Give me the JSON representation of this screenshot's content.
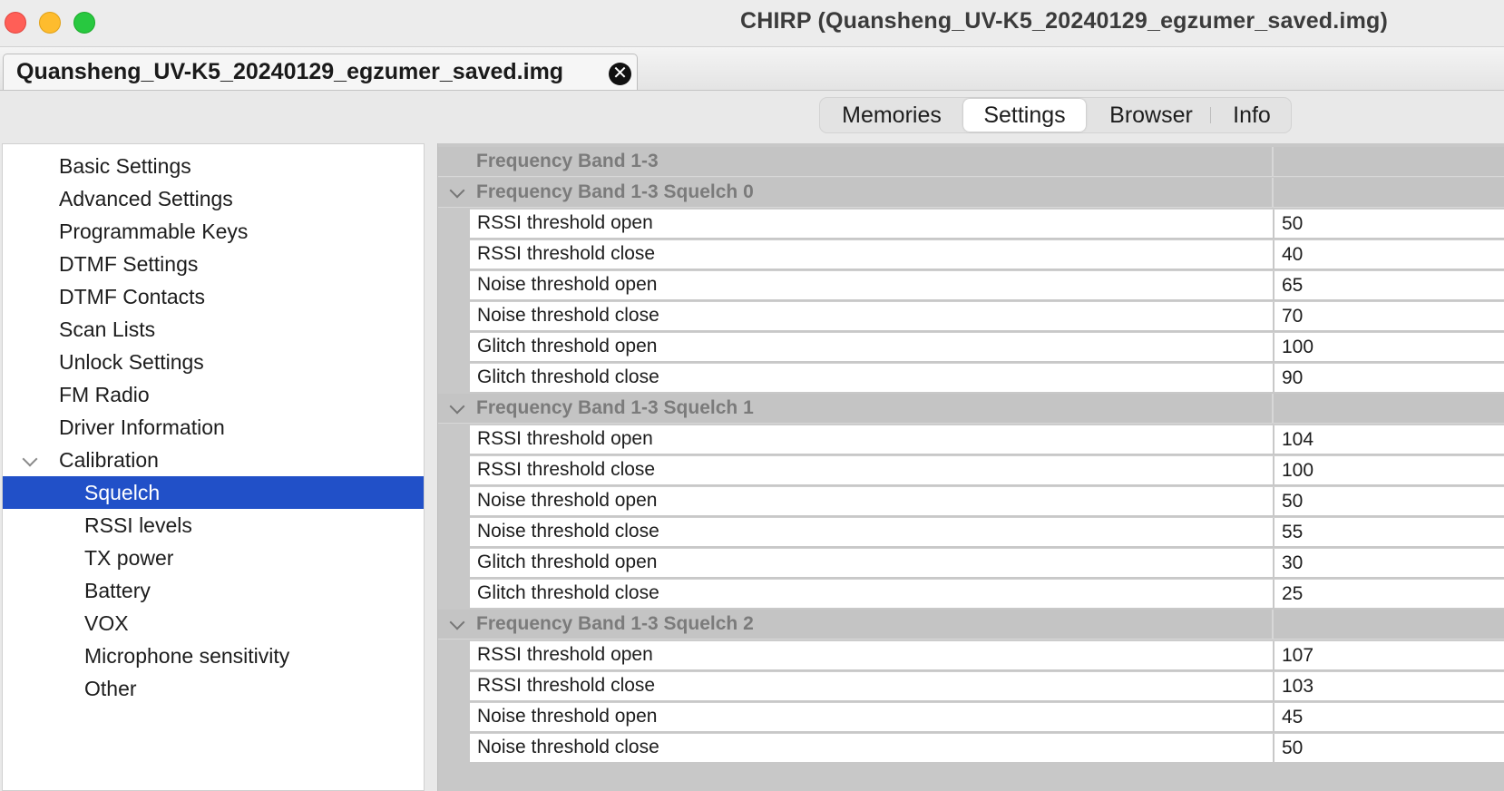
{
  "window": {
    "title": "CHIRP (Quansheng_UV-K5_20240129_egzumer_saved.img)"
  },
  "doc_tab": {
    "label": "Quansheng_UV-K5_20240129_egzumer_saved.img",
    "close_icon": "close-icon"
  },
  "view_tabs": {
    "items": [
      "Memories",
      "Settings",
      "Browser",
      "Info"
    ],
    "selected": "Settings"
  },
  "tree": {
    "items": [
      {
        "label": "Basic Settings",
        "level": 0
      },
      {
        "label": "Advanced Settings",
        "level": 0
      },
      {
        "label": "Programmable Keys",
        "level": 0
      },
      {
        "label": "DTMF Settings",
        "level": 0
      },
      {
        "label": "DTMF Contacts",
        "level": 0
      },
      {
        "label": "Scan Lists",
        "level": 0
      },
      {
        "label": "Unlock Settings",
        "level": 0
      },
      {
        "label": "FM Radio",
        "level": 0
      },
      {
        "label": "Driver Information",
        "level": 0
      },
      {
        "label": "Calibration",
        "level": 0,
        "expanded": true
      },
      {
        "label": "Squelch",
        "level": 1,
        "selected": true
      },
      {
        "label": "RSSI levels",
        "level": 1
      },
      {
        "label": "TX power",
        "level": 1
      },
      {
        "label": "Battery",
        "level": 1
      },
      {
        "label": "VOX",
        "level": 1
      },
      {
        "label": "Microphone sensitivity",
        "level": 1
      },
      {
        "label": "Other",
        "level": 1
      }
    ],
    "selection_color": "#2150c8"
  },
  "settings": {
    "header": "Frequency Band 1-3",
    "groups": [
      {
        "title": "Frequency Band 1-3 Squelch 0",
        "rows": [
          {
            "name": "RSSI threshold open",
            "value": "50"
          },
          {
            "name": "RSSI threshold close",
            "value": "40"
          },
          {
            "name": "Noise threshold open",
            "value": "65"
          },
          {
            "name": "Noise threshold close",
            "value": "70"
          },
          {
            "name": "Glitch threshold open",
            "value": "100"
          },
          {
            "name": "Glitch threshold close",
            "value": "90"
          }
        ]
      },
      {
        "title": "Frequency Band 1-3 Squelch 1",
        "rows": [
          {
            "name": "RSSI threshold open",
            "value": "104"
          },
          {
            "name": "RSSI threshold close",
            "value": "100"
          },
          {
            "name": "Noise threshold open",
            "value": "50"
          },
          {
            "name": "Noise threshold close",
            "value": "55"
          },
          {
            "name": "Glitch threshold open",
            "value": "30"
          },
          {
            "name": "Glitch threshold close",
            "value": "25"
          }
        ]
      },
      {
        "title": "Frequency Band 1-3 Squelch 2",
        "rows": [
          {
            "name": "RSSI threshold open",
            "value": "107"
          },
          {
            "name": "RSSI threshold close",
            "value": "103"
          },
          {
            "name": "Noise threshold open",
            "value": "45"
          },
          {
            "name": "Noise threshold close",
            "value": "50"
          }
        ]
      }
    ]
  }
}
